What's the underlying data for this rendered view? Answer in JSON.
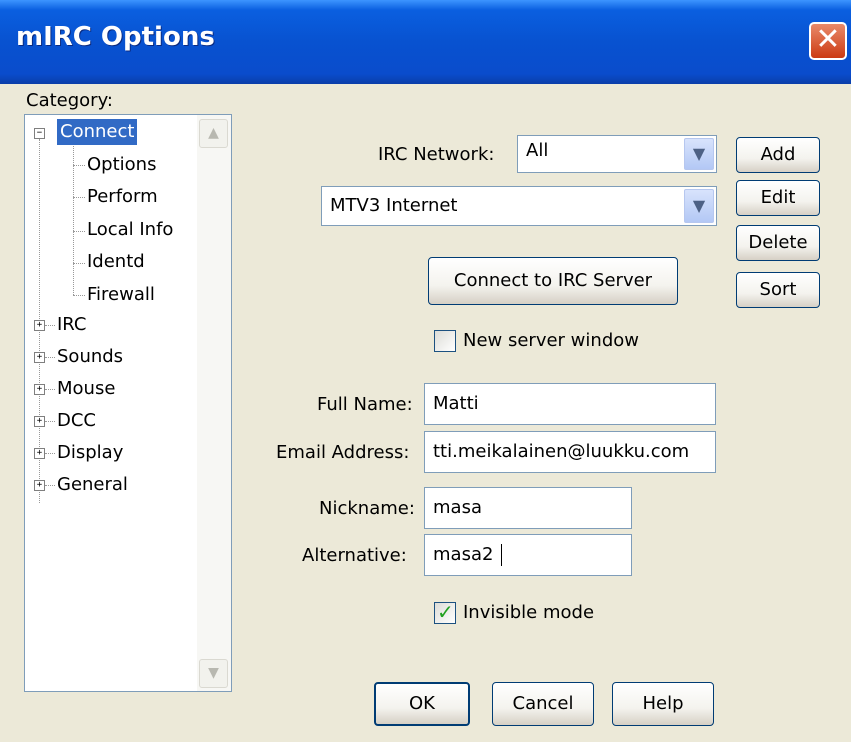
{
  "window": {
    "title": "mIRC Options",
    "close_icon": "close-icon"
  },
  "category": {
    "label": "Category:",
    "items": [
      {
        "label": "Connect",
        "expander": "⊟",
        "selected": true
      },
      {
        "label": "Options"
      },
      {
        "label": "Perform"
      },
      {
        "label": "Local Info"
      },
      {
        "label": "Identd"
      },
      {
        "label": "Firewall"
      },
      {
        "label": "IRC",
        "expander": "⊞"
      },
      {
        "label": "Sounds",
        "expander": "⊞"
      },
      {
        "label": "Mouse",
        "expander": "⊞"
      },
      {
        "label": "DCC",
        "expander": "⊞"
      },
      {
        "label": "Display",
        "expander": "⊞"
      },
      {
        "label": "General",
        "expander": "⊞"
      }
    ],
    "scroll_up_icon": "scroll-up-arrow-icon",
    "scroll_down_icon": "scroll-down-arrow-icon"
  },
  "connect": {
    "irc_network_label": "IRC Network:",
    "irc_network_value": "All",
    "server_value": "MTV3 Internet",
    "add_label": "Add",
    "edit_label": "Edit",
    "delete_label": "Delete",
    "sort_label": "Sort",
    "connect_button": "Connect to IRC Server",
    "new_server_window_label": "New server window",
    "new_server_window_checked": false,
    "full_name_label": "Full Name:",
    "full_name_value": "Matti",
    "email_label": "Email Address:",
    "email_value": "tti.meikalainen@luukku.com",
    "nickname_label": "Nickname:",
    "nickname_value": "masa",
    "alternative_label": "Alternative:",
    "alternative_value": "masa2",
    "invisible_mode_label": "Invisible mode",
    "invisible_mode_checked": true
  },
  "footer": {
    "ok_label": "OK",
    "cancel_label": "Cancel",
    "help_label": "Help"
  },
  "colors": {
    "title_bar": "#0a5fe0",
    "selected_item": "#316ac5",
    "dialog_bg": "#ece9d8",
    "check_green": "#21a121"
  }
}
